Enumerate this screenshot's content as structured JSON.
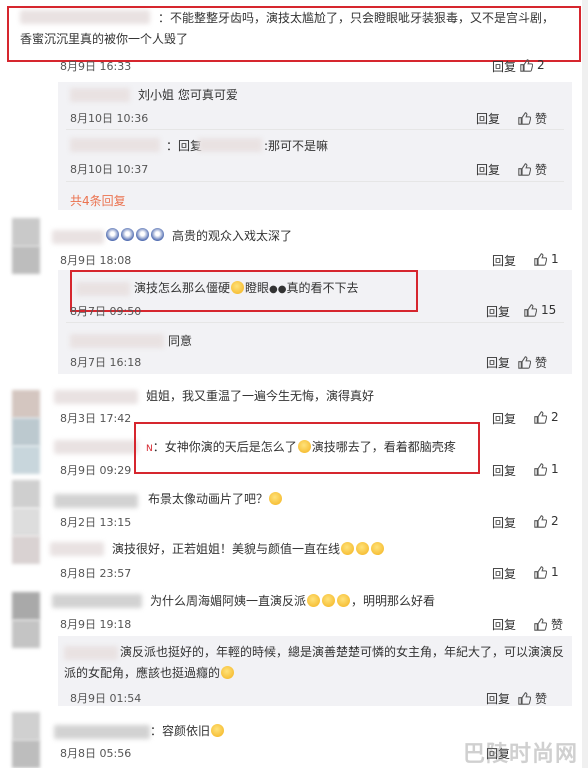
{
  "comments": [
    {
      "text": "：不能整整牙齿吗，演技太尴尬了，只会瞪眼呲牙装狠毒，又不是宫斗剧，香蜜沉沉里真的被你一个人毁了",
      "time": "8月9日 16:33",
      "reply": "回复",
      "likes": "2"
    },
    {
      "text": "刘小姐  您可真可爱",
      "time": "8月10日 10:36",
      "reply": "回复",
      "like_label": "赞"
    },
    {
      "text_a": "：回复",
      "text_b": ":那可不是嘛",
      "time": "8月10日 10:37",
      "reply": "回复",
      "like_label": "赞"
    },
    {
      "more": "共4条回复"
    },
    {
      "text": "高贵的观众入戏太深了",
      "time": "8月9日 18:08",
      "reply": "回复",
      "likes": "1"
    },
    {
      "text_a": "演技怎么那么僵硬",
      "text_b": "瞪眼",
      "text_c": "真的看不下去",
      "time": "8月7日 09:50",
      "reply": "回复",
      "likes": "15"
    },
    {
      "text": "同意",
      "time": "8月7日 16:18",
      "reply": "回复",
      "like_label": "赞"
    },
    {
      "text": "姐姐，我又重温了一遍今生无悔，演得真好",
      "time": "8月3日 17:42",
      "reply": "回复",
      "likes": "2"
    },
    {
      "text_a": "：女神你演的天后是怎么了",
      "text_b": "演技哪去了，看着都脑壳疼",
      "time": "8月9日 09:29",
      "reply": "回复",
      "likes": "1"
    },
    {
      "text": "布景太像动画片了吧？",
      "time": "8月2日 13:15",
      "reply": "回复",
      "likes": "2"
    },
    {
      "text": "演技很好，正若姐姐！美貌与颜值一直在线",
      "time": "8月8日 23:57",
      "reply": "回复",
      "likes": "1"
    },
    {
      "text_a": "为什么周海媚阿姨一直演反派",
      "text_b": "，明明那么好看",
      "time": "8月9日 19:18",
      "reply": "回复",
      "like_label": "赞"
    },
    {
      "text": "演反派也挺好的，年輕的時候，總是演善楚楚可憐的女主角，年紀大了，可以演演反派的女配角，應該也挺過癮的",
      "time": "8月9日 01:54",
      "reply": "回复",
      "like_label": "赞"
    },
    {
      "text": "：容颜依旧",
      "time": "8月8日 05:56",
      "reply": "回复",
      "likes": "1"
    }
  ],
  "watermark": "巴陵时尚网",
  "colors": {
    "highlight_border": "#d6262e",
    "link": "#eb7350",
    "reply_bg": "#f2f2f5"
  }
}
